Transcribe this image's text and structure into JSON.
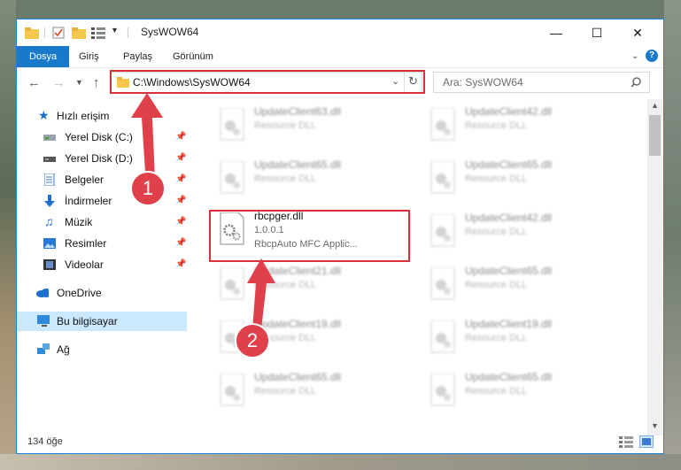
{
  "window": {
    "title": "SysWOW64",
    "controls": {
      "minimize": "—",
      "maximize": "☐",
      "close": "✕"
    }
  },
  "ribbon": {
    "tabs": [
      "Dosya",
      "Giriş",
      "Paylaş",
      "Görünüm"
    ],
    "help": "?"
  },
  "address": {
    "path": "C:\\Windows\\SysWOW64",
    "search_placeholder": "Ara: SysWOW64"
  },
  "sidebar": {
    "quick_access": "Hızlı erişim",
    "items": [
      {
        "label": "Yerel Disk (C:)",
        "icon": "drive-icon"
      },
      {
        "label": "Yerel Disk (D:)",
        "icon": "drive-icon"
      },
      {
        "label": "Belgeler",
        "icon": "documents-icon"
      },
      {
        "label": "İndirmeler",
        "icon": "downloads-icon"
      },
      {
        "label": "Müzik",
        "icon": "music-icon"
      },
      {
        "label": "Resimler",
        "icon": "pictures-icon"
      },
      {
        "label": "Videolar",
        "icon": "videos-icon"
      }
    ],
    "onedrive": "OneDrive",
    "this_pc": "Bu bilgisayar",
    "network": "Ağ"
  },
  "files": {
    "highlighted": {
      "name": "rbcpger.dll",
      "version": "1.0.0.1",
      "description": "RbcpAuto MFC Applic..."
    },
    "left_column": [
      {
        "name": "UpdateClient63.dll",
        "type": "Resource DLL"
      },
      {
        "name": "UpdateClient65.dll",
        "type": "Resource DLL"
      },
      {
        "name": "UpdateClient21.dll",
        "type": "Resource DLL"
      },
      {
        "name": "UpdateClient19.dll",
        "type": "Resource DLL"
      },
      {
        "name": "UpdateClient65.dll",
        "type": "Resource DLL"
      }
    ],
    "right_column": [
      {
        "name": "UpdateClient42.dll",
        "type": "Resource DLL"
      },
      {
        "name": "UpdateClient65.dll",
        "type": "Resource DLL"
      },
      {
        "name": "UpdateClient42.dll",
        "type": "Resource DLL"
      },
      {
        "name": "UpdateClient65.dll",
        "type": "Resource DLL"
      },
      {
        "name": "UpdateClient19.dll",
        "type": "Resource DLL"
      },
      {
        "name": "UpdateClient65.dll",
        "type": "Resource DLL"
      }
    ]
  },
  "status": {
    "item_count": "134 öğe"
  },
  "callouts": [
    "1",
    "2"
  ],
  "colors": {
    "accent": "#1979ca",
    "highlight_box": "#d9303a",
    "callout": "#e0404a"
  }
}
